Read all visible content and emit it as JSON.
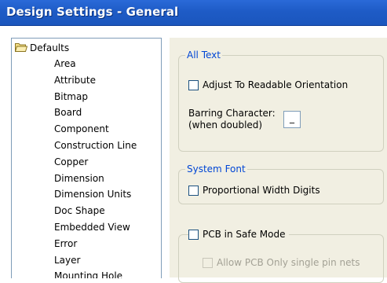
{
  "window": {
    "title": "Design Settings - General"
  },
  "tree": {
    "root_label": "Defaults",
    "items": [
      "Area",
      "Attribute",
      "Bitmap",
      "Board",
      "Component",
      "Construction Line",
      "Copper",
      "Dimension",
      "Dimension Units",
      "Doc Shape",
      "Embedded View",
      "Error",
      "Layer",
      "Mounting Hole"
    ]
  },
  "all_text": {
    "legend": "All Text",
    "adjust_label": "Adjust To Readable Orientation",
    "adjust_checked": false,
    "barring_label_line1": "Barring Character:",
    "barring_label_line2": "(when doubled)",
    "barring_value": "_"
  },
  "system_font": {
    "legend": "System Font",
    "proportional_label": "Proportional Width Digits",
    "proportional_checked": false
  },
  "safe_mode": {
    "label": "PCB in Safe Mode",
    "checked": false,
    "single_pin_label": "Allow PCB Only single pin nets",
    "single_pin_checked": false,
    "single_pin_disabled": true
  },
  "colors": {
    "title_bar": "#1e5bc6",
    "panel": "#f1efe2",
    "legend_text": "#0046d5"
  }
}
